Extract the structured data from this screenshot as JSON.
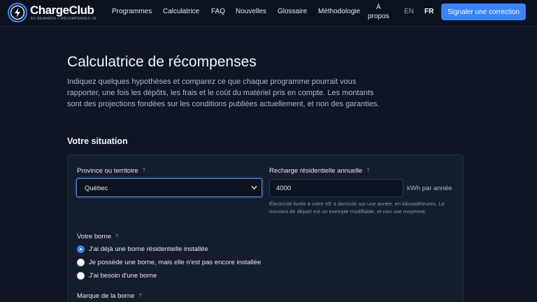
{
  "brand": {
    "name": "ChargeClub",
    "tagline": "EV REWARDS + RÉCOMPENSES VE",
    "accent": "#3b82f6"
  },
  "nav": {
    "items": [
      "Programmes",
      "Calculatrice",
      "FAQ",
      "Nouvelles",
      "Glossaire",
      "Méthodologie"
    ],
    "about_line1": "À",
    "about_line2": "propos",
    "lang_en": "EN",
    "lang_fr": "FR",
    "cta": "Signaler une correction"
  },
  "page": {
    "title": "Calculatrice de récompenses",
    "intro": "Indiquez quelques hypothèses et comparez ce que chaque programme pourrait vous rapporter, une fois les dépôts, les frais et le coût du matériel pris en compte. Les montants sont des projections fondées sur les conditions publiées actuellement, et non des garanties.",
    "section_heading": "Votre situation"
  },
  "form": {
    "province": {
      "label": "Province ou territoire",
      "help": "?",
      "selected": "Québec"
    },
    "charging": {
      "label": "Recharge résidentielle annuelle",
      "help": "?",
      "value": "4000",
      "unit": "kWh par année",
      "hint": "Électricité livrée à votre VE à domicile sur une année, en kilowattheures. Le montant de départ est un exemple modifiable, et non une moyenne."
    },
    "charger": {
      "label": "Votre borne",
      "help": "?",
      "options": [
        "J'ai déjà une borne résidentielle installée",
        "Je possède une borne, mais elle n'est pas encore installée",
        "J'ai besoin d'une borne"
      ],
      "selected_index": 0
    },
    "brand_field": {
      "label": "Marque de la borne",
      "help": "?"
    }
  }
}
